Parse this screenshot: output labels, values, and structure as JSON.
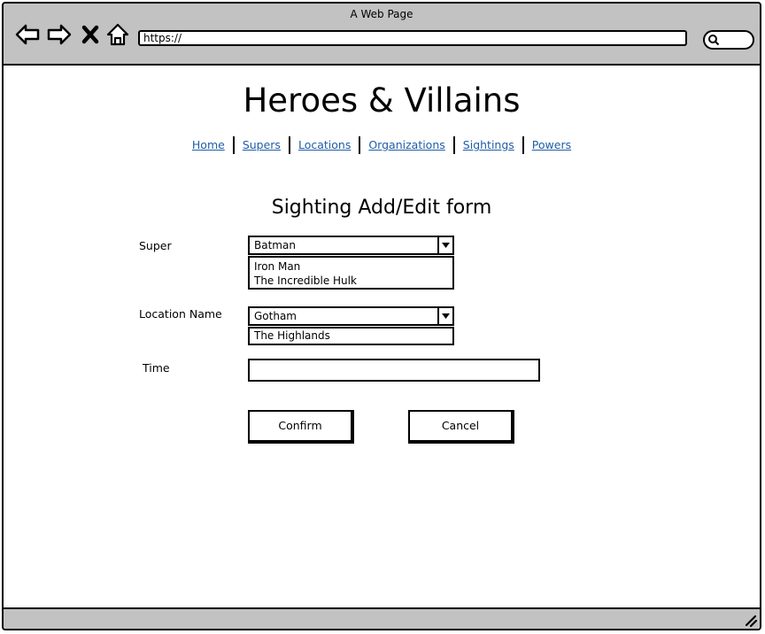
{
  "browser": {
    "window_title": "A Web Page",
    "url": "https://"
  },
  "page": {
    "title": "Heroes & Villains",
    "nav": [
      "Home",
      "Supers",
      "Locations",
      "Organizations",
      "Sightings",
      "Powers"
    ]
  },
  "form": {
    "title": "Sighting Add/Edit form",
    "super": {
      "label": "Super",
      "selected": "Batman",
      "options": [
        "Iron Man",
        "The Incredible Hulk"
      ]
    },
    "location": {
      "label": "Location Name",
      "selected": "Gotham",
      "options": [
        "The Highlands"
      ]
    },
    "time": {
      "label": "Time",
      "value": ""
    },
    "confirm_label": "Confirm",
    "cancel_label": "Cancel"
  },
  "icons": {
    "back": "back-arrow-icon",
    "forward": "forward-arrow-icon",
    "stop": "close-icon",
    "home": "home-icon",
    "search": "search-icon",
    "resize": "resize-grip-icon"
  },
  "colors": {
    "chrome": "#c2c2c2",
    "link": "#1f5da8"
  }
}
